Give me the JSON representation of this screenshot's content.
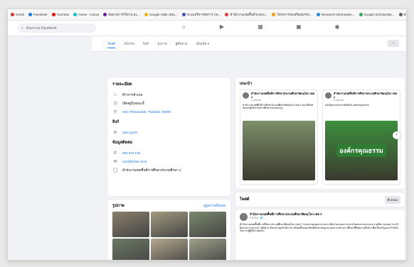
{
  "bookmarks": [
    {
      "label": "Gmail",
      "color": "#d93025"
    },
    {
      "label": "Facebook",
      "color": "#1877f2"
    },
    {
      "label": "YouTube",
      "color": "#ff0000"
    },
    {
      "label": "Home - Canva",
      "color": "#00c4cc"
    },
    {
      "label": "ต่ออายุการใช้งาน EL...",
      "color": "#6a1b9a"
    },
    {
      "label": "Google Slide เทมเ...",
      "color": "#f4b400"
    },
    {
      "label": "ระบบบริหารจัดการ (IS...",
      "color": "#3f51b5"
    },
    {
      "label": "สำนักงานเขตพื้นที่ ESDC...",
      "color": "#e53935"
    },
    {
      "label": "โครงการส่งเสริมสมรรถ...",
      "color": "#ff9800"
    },
    {
      "label": "Research Information...",
      "color": "#1e88e5"
    },
    {
      "label": "Google Scholarship...",
      "color": "#34a853"
    },
    {
      "label": "ผลิตภัณฑ์...",
      "color": "#5f6368"
    }
  ],
  "search": {
    "placeholder": "ค้นหาบน Facebook"
  },
  "nav_icons": [
    "home-icon",
    "video-icon",
    "marketplace-icon",
    "groups-icon",
    "gaming-icon"
  ],
  "tabs": [
    {
      "label": "โพสต์",
      "active": true
    },
    {
      "label": "เกี่ยวกับ",
      "active": false
    },
    {
      "label": "รีลส์",
      "active": false
    },
    {
      "label": "รูปภาพ",
      "active": false
    },
    {
      "label": "ผู้ติดตาม",
      "active": false
    },
    {
      "label": "เพิ่มเติม ▾",
      "active": false
    }
  ],
  "more_button": "···",
  "intro": {
    "title": "รายละเอียด",
    "rows": [
      {
        "icon": "☆",
        "name": "star-icon",
        "text": "ที่ว่าการอำเภอ",
        "link": false
      },
      {
        "icon": "◷",
        "name": "clock-icon",
        "text": "เปิดอยู่ในขณะนี้",
        "link": false
      },
      {
        "icon": "⚲",
        "name": "location-pin-icon",
        "text": "456, Phitsanulok, Thailand, 65000",
        "link": true
      }
    ],
    "link_title": "ลิงก์",
    "link_row": {
      "icon": "⊘",
      "name": "link-icon",
      "text": "obec.go.th"
    },
    "contact_title": "ข้อมูลติดต่อ",
    "contact_rows": [
      {
        "icon": "✆",
        "name": "phone-icon",
        "text": "055 013 136",
        "link": true
      },
      {
        "icon": "✉",
        "name": "email-icon",
        "text": "saraf@obec.moe",
        "link": true
      },
      {
        "icon": "◯",
        "name": "messenger-icon",
        "text": "สำนักงานเขตพื้นที่การศึกษาประถมศึกษา 2",
        "link": false
      }
    ]
  },
  "photos": {
    "title": "รูปภาพ",
    "see_all": "ดูรูปภาพทั้งหมด",
    "colors": [
      "#8a7f6a",
      "#a39b80",
      "#7b8a6e",
      "#6c7a64",
      "#b5a98d",
      "#9fa18a"
    ]
  },
  "featured": {
    "title": "แนะนำ",
    "items": [
      {
        "name": "สำนักงานเขตพื้นที่การศึกษาประถมศึกษาพิษณุโลก เขต 2",
        "date": "1 เมษายน",
        "text": "สำนักงานเขตพื้นที่การศึกษาประถมศึกษาพิษณุโลก เขต 2 มอบเกียรติบัตรแก่ผู้บริหารสถานศึกษาและคณะครู",
        "img_color": "#7d8f6a"
      },
      {
        "name": "สำนักงานเขตพื้นที่การศึกษาประถมศึกษาพิษณุโลก เขต 2",
        "date": "5 เมษายน",
        "text": "ขอเชิญร่วมประชาสัมพันธ์ องค์กรคุณธรรม",
        "img_color": "#3d8f3e"
      }
    ],
    "banner": "องค์กรคุณธรรม"
  },
  "posts": {
    "title": "โพสต์",
    "filter": "ตัวกรอง",
    "author": "สำนักงานเขตพื้นที่การศึกษาประถมศึกษาพิษณุโลก เขต 2",
    "date": "2 ชั่วโมง · 🌐",
    "text": "สำนักงานเขตพื้นที่การศึกษาประถมศึกษาพิษณุโลก เขต 2 ร่วมประชุมคณะกรรมการพิจารณาผลการประเมินสมรรถนะและความดีความชอบ ประจำปีงบประมาณ พ.ศ. 2568 ณ ห้องประชุมสำนักงาน พร้อมทั้งมอบเกียรติบัตรแก่ครูและบุคลากรทางการศึกษาที่มีผลงานดีเด่น เพื่อเป็นขวัญและกำลังใจในการปฏิบัติงานต่อไป"
  }
}
